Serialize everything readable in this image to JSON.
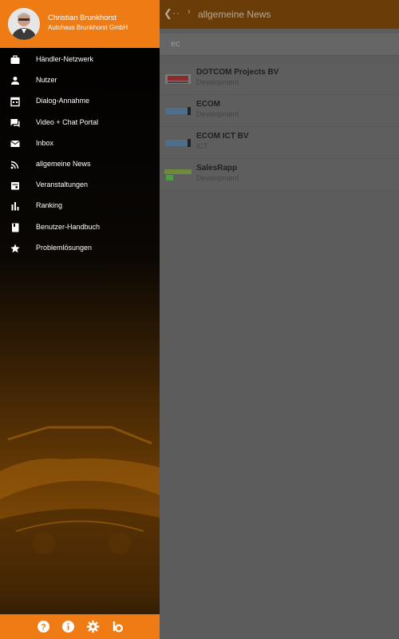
{
  "user": {
    "name": "Christian Brunkhorst",
    "company": "Autohaus Brunkhorst GmbH"
  },
  "menu": [
    {
      "label": "Händler-Netzwerk",
      "icon": "briefcase-icon"
    },
    {
      "label": "Nutzer",
      "icon": "person-icon"
    },
    {
      "label": "Dialog-Annahme",
      "icon": "calendar-grid-icon"
    },
    {
      "label": "Video + Chat Portal",
      "icon": "chat-icon"
    },
    {
      "label": "Inbox",
      "icon": "mail-icon"
    },
    {
      "label": "allgemeine News",
      "icon": "rss-icon"
    },
    {
      "label": "Veranstaltungen",
      "icon": "event-icon"
    },
    {
      "label": "Ranking",
      "icon": "bar-chart-icon"
    },
    {
      "label": "Benutzer-Handbuch",
      "icon": "book-icon"
    },
    {
      "label": "Problemlösungen",
      "icon": "star-icon"
    }
  ],
  "footer_icons": [
    "help-icon",
    "info-icon",
    "settings-icon",
    "brand-logo-icon"
  ],
  "app": {
    "title": "allgemeine News",
    "search_value": "ec",
    "results": [
      {
        "name": "DOTCOM Projects BV",
        "sub": "Development"
      },
      {
        "name": "ECOM",
        "sub": "Development"
      },
      {
        "name": "ECOM ICT BV",
        "sub": "ICT"
      },
      {
        "name": "SalesRapp",
        "sub": "Development"
      }
    ]
  },
  "colors": {
    "accent": "#ef7b15",
    "toolbar": "#6a3d08",
    "scrim": "#5c5c5c"
  }
}
